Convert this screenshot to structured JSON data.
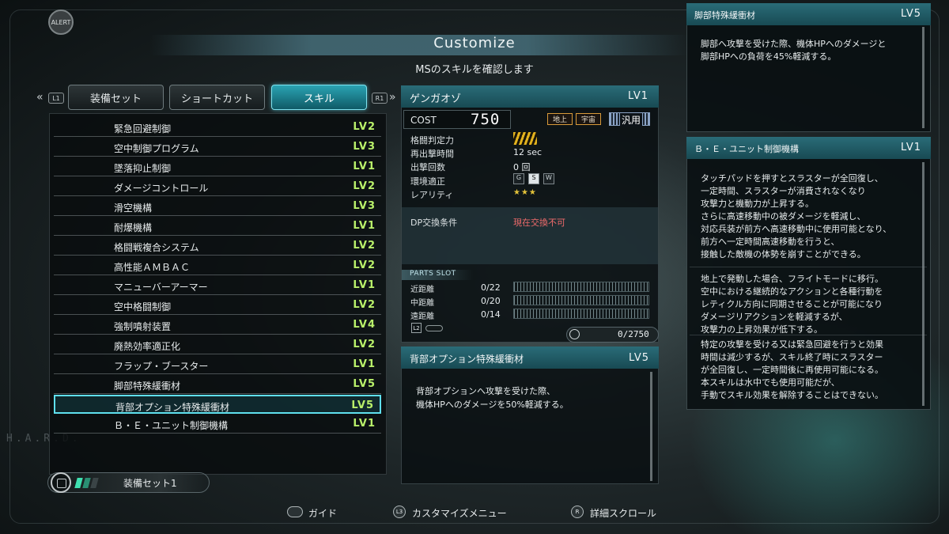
{
  "header": {
    "alert": "ALERT",
    "title": "Customize",
    "subtitle": "MSのスキルを確認します"
  },
  "frame": {
    "side_text": "H.A.R.D."
  },
  "tabs": {
    "left_key": "L1",
    "right_key": "R1",
    "items": [
      {
        "label": "装備セット"
      },
      {
        "label": "ショートカット"
      },
      {
        "label": "スキル",
        "active": true
      }
    ]
  },
  "skills": [
    {
      "name": "緊急回避制御",
      "level": "LV2"
    },
    {
      "name": "空中制御プログラム",
      "level": "LV3"
    },
    {
      "name": "墜落抑止制御",
      "level": "LV1"
    },
    {
      "name": "ダメージコントロール",
      "level": "LV2"
    },
    {
      "name": "滑空機構",
      "level": "LV3"
    },
    {
      "name": "耐爆機構",
      "level": "LV1"
    },
    {
      "name": "格闘戦複合システム",
      "level": "LV2"
    },
    {
      "name": "高性能ＡＭＢＡＣ",
      "level": "LV2"
    },
    {
      "name": "マニューバーアーマー",
      "level": "LV1"
    },
    {
      "name": "空中格闘制御",
      "level": "LV2"
    },
    {
      "name": "強制噴射装置",
      "level": "LV4"
    },
    {
      "name": "廃熱効率適正化",
      "level": "LV2"
    },
    {
      "name": "フラップ・ブースター",
      "level": "LV1"
    },
    {
      "name": "脚部特殊緩衝材",
      "level": "LV5"
    },
    {
      "name": "背部オプション特殊緩衝材",
      "level": "LV5",
      "selected": true
    },
    {
      "name": "Ｂ・Ｅ・ユニット制御機構",
      "level": "LV1"
    }
  ],
  "loadout": {
    "label": "装備セット1",
    "bars": [
      "#3fe0b0",
      "#2a8f73",
      "#3a4446"
    ]
  },
  "unit": {
    "name": "ゲンガオゾ",
    "level": "LV1",
    "cost_label": "COST",
    "cost": "750",
    "terrain": [
      "地上",
      "宇宙"
    ],
    "type": "汎用",
    "stats": [
      {
        "label": "格闘判定力",
        "value": ""
      },
      {
        "label": "再出撃時間",
        "value": "12 sec"
      },
      {
        "label": "出撃回数",
        "value": "0 回"
      },
      {
        "label": "環境適正",
        "value": ""
      },
      {
        "label": "レアリティ",
        "value": "★★★"
      }
    ],
    "rank_labels": "A1A2 A3",
    "environment": [
      "G",
      "S",
      "W"
    ],
    "dp_label": "DP交換条件",
    "dp_value": "現在交換不可",
    "parts_title": "PARTS SLOT",
    "parts": [
      {
        "label": "近距離",
        "value": "0/22"
      },
      {
        "label": "中距離",
        "value": "0/20"
      },
      {
        "label": "遠距離",
        "value": "0/14"
      }
    ],
    "l2_key": "L2",
    "slot_total": "0/2750"
  },
  "detail": {
    "title": "背部オプション特殊緩衝材",
    "level": "LV5",
    "text": "背部オプションへ攻撃を受けた際、\n機体HPへのダメージを50%軽減する。"
  },
  "side_panels": [
    {
      "title": "脚部特殊緩衝材",
      "level": "LV5",
      "text": "脚部へ攻撃を受けた際、機体HPへのダメージと\n脚部HPへの負荷を45%軽減する。"
    },
    {
      "title": "Ｂ・Ｅ・ユニット制御機構",
      "level": "LV1",
      "text1": "タッチパッドを押すとスラスターが全回復し、\n一定時間、スラスターが消費されなくなり\n攻撃力と機動力が上昇する。\nさらに高速移動中の被ダメージを軽減し、\n対応兵装が前方へ高速移動中に使用可能となり、\n前方へ一定時間高速移動を行うと、\n接触した敵機の体勢を崩すことができる。",
      "text2": "地上で発動した場合、フライトモードに移行。\n空中における継続的なアクションと各種行動を\nレティクル方向に同期させることが可能になり\nダメージリアクションを軽減するが、\n攻撃力の上昇効果が低下する。",
      "text3": "特定の攻撃を受ける又は緊急回避を行うと効果\n時間は減少するが、スキル終了時にスラスター\nが全回復し、一定時間後に再使用可能になる。\n本スキルは水中でも使用可能だが、\n手動でスキル効果を解除することはできない。"
    }
  ],
  "footer": [
    {
      "icon": "",
      "label": "ガイド"
    },
    {
      "icon": "L3",
      "label": "カスタマイズメニュー"
    },
    {
      "icon": "R",
      "label": "詳細スクロール"
    }
  ],
  "colors": {
    "accent": "#5fe0ee",
    "level": "#b9f06a",
    "warning": "#f06b6b",
    "header": "#2a6c78"
  }
}
